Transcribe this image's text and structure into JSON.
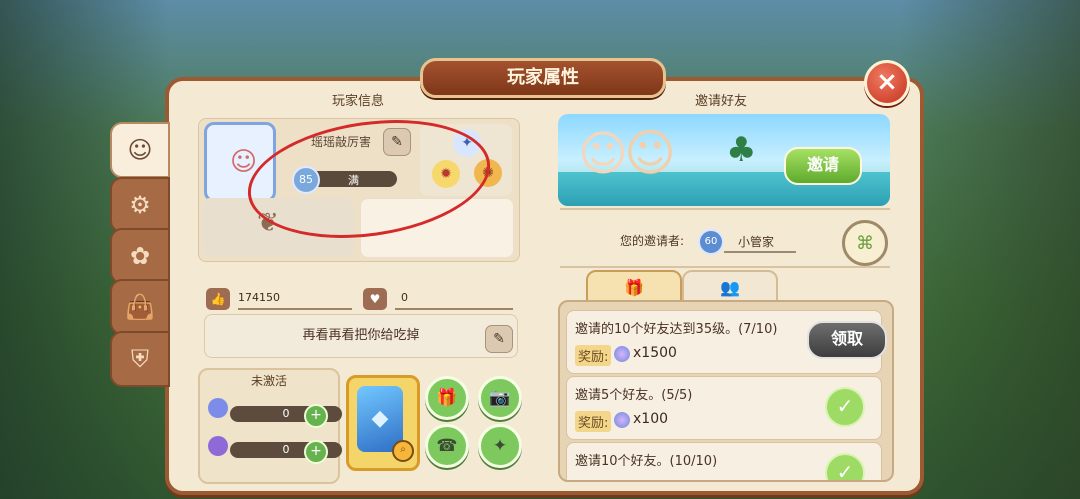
{
  "title": "玩家属性",
  "left_section": {
    "header": "玩家信息",
    "player": {
      "name": "瑶瑶敲厉害",
      "level": "85",
      "level_status": "满"
    },
    "likes": "174150",
    "gifts": "0",
    "motto": "再看再看把你给吃掉",
    "activation": {
      "label": "未激活",
      "slot1_value": "0",
      "slot2_value": "0"
    }
  },
  "right_section": {
    "header": "邀请好友",
    "invite_button": "邀请",
    "inviter_label": "您的邀请者:",
    "inviter_level": "60",
    "inviter_name": "小管家",
    "tabs": [
      "gift-tab",
      "friends-tab"
    ],
    "rewards": [
      {
        "task": "邀请的10个好友达到35级。(7/10)",
        "label": "奖励:",
        "value": "x1500",
        "action": "领取"
      },
      {
        "task": "邀请5个好友。(5/5)",
        "label": "奖励:",
        "value": "x100",
        "action": "completed"
      },
      {
        "task": "邀请10个好友。(10/10)",
        "label": "",
        "value": "",
        "action": "completed"
      }
    ]
  },
  "icons": {
    "close": "close-icon",
    "profile": "profile-icon",
    "settings": "gear-icon",
    "gift": "gift-icon",
    "camera": "camera-icon",
    "support": "support-icon",
    "magic": "magic-icon",
    "scan": "scan-icon"
  },
  "colors": {
    "frame": "#9c5a33",
    "panel": "#f4ead3",
    "accent_green": "#7dc95d",
    "alert_red": "#d42a2a"
  }
}
